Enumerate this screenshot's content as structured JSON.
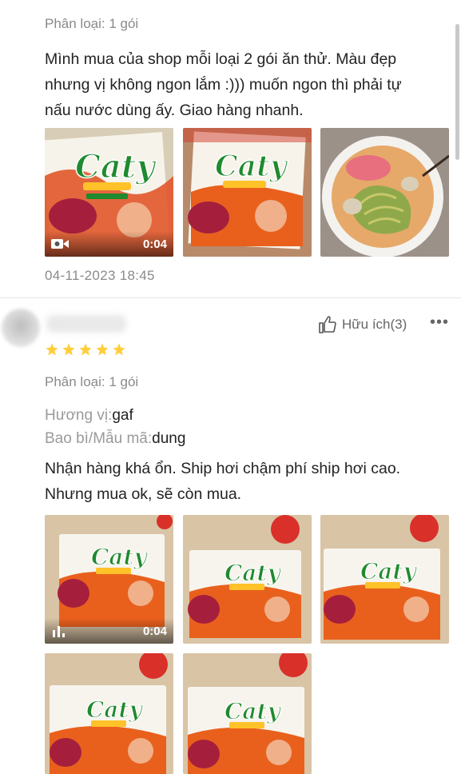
{
  "review_1": {
    "variant": "Phân loại: 1 gói",
    "text_lines": [
      "Mình mua của shop mỗi loại 2 gói ăn thử. Màu đẹp",
      "nhưng vị không ngon lắm :))) muốn ngon thì phải tự",
      "nấu nước dùng ấy. Giao hàng nhanh."
    ],
    "media": [
      {
        "type": "video",
        "duration": "0:04",
        "subject": "noodle-package-photo"
      },
      {
        "type": "image",
        "subject": "noodle-package-photo"
      },
      {
        "type": "image",
        "subject": "noodle-bowl-photo"
      }
    ],
    "timestamp": "04-11-2023 18:45"
  },
  "review_2": {
    "stars": 5,
    "star_color": "#ffce3d",
    "helpful_label": "Hữu ích(3)",
    "more_label": "•••",
    "variant": "Phân loại: 1 gói",
    "attributes": [
      {
        "key": "Hương vị:",
        "value": "gaf"
      },
      {
        "key": "Bao bì/Mẫu mã:",
        "value": "dung"
      }
    ],
    "text_lines": [
      "Nhận hàng khá ổn. Ship hơi chậm phí ship hơi cao.",
      "Nhưng mua ok, sẽ còn mua."
    ],
    "media": [
      {
        "type": "video",
        "duration": "0:04",
        "subject": "noodle-package-photo"
      },
      {
        "type": "image",
        "subject": "noodle-package-photo"
      },
      {
        "type": "image",
        "subject": "noodle-package-photo"
      },
      {
        "type": "image",
        "subject": "noodle-package-photo"
      },
      {
        "type": "image",
        "subject": "noodle-package-photo"
      }
    ]
  },
  "package_brand": "Caty",
  "colors": {
    "text_primary": "#222222",
    "text_muted": "#8a8a8a",
    "brand_green": "#1f8a2e",
    "package_orange": "#e9601d"
  }
}
